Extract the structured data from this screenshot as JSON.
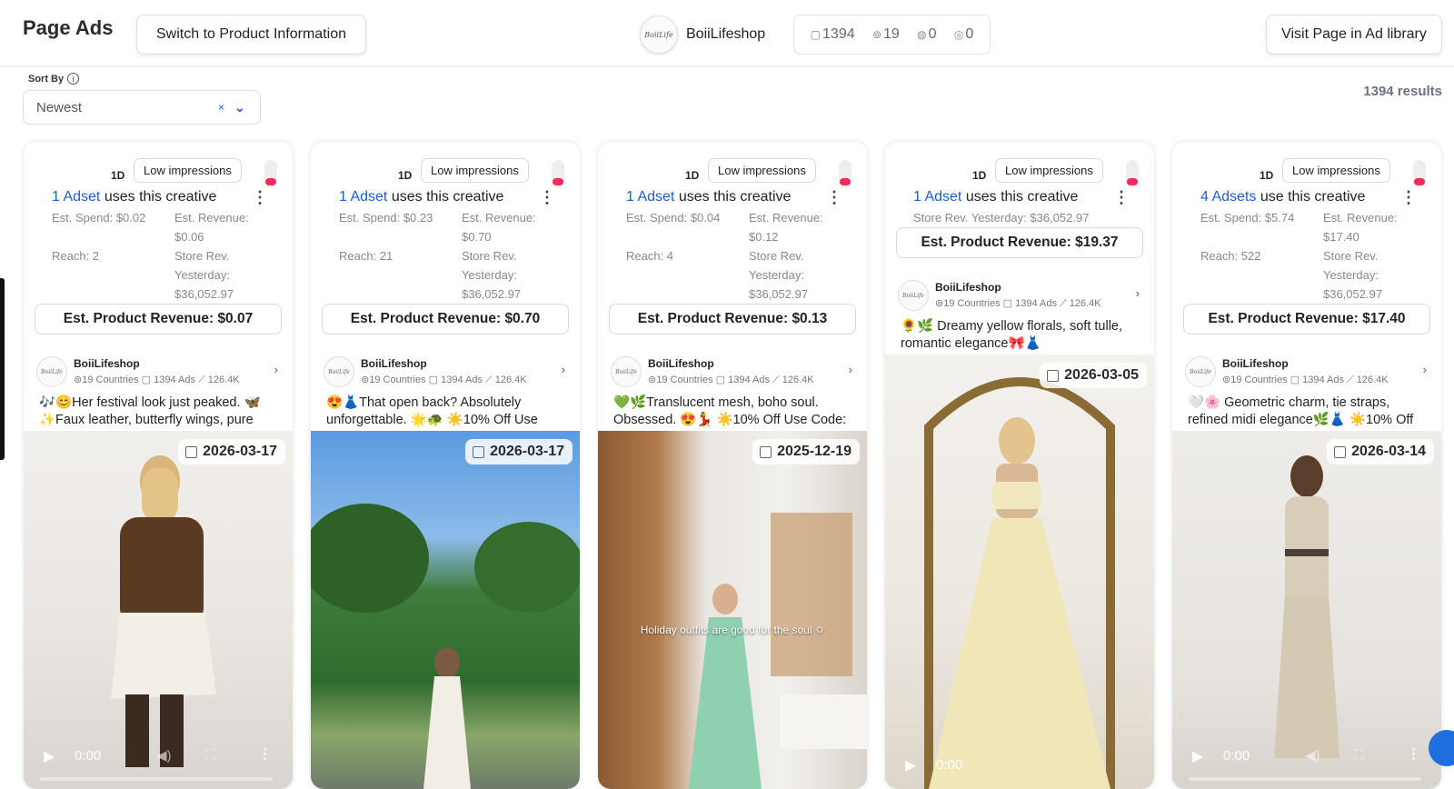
{
  "header": {
    "title": "Page Ads",
    "switch_label": "Switch to Product Information",
    "shop_name": "BoiiLifeshop",
    "shop_logo_text": "BoiiLife",
    "stats": {
      "ads": "1394",
      "countries": "19",
      "fb": "0",
      "ig": "0"
    },
    "visit_label": "Visit Page in Ad library"
  },
  "sort": {
    "label": "Sort By",
    "value": "Newest",
    "clear": "×",
    "info": "i"
  },
  "results_text": "1394 results",
  "cards": [
    {
      "age": "1D",
      "badge": "Low impressions",
      "adset_link": "1 Adset",
      "adset_rest": " uses this creative",
      "spend": "Est. Spend: $0.02",
      "reach": "Reach: 2",
      "revenue_lines": [
        "Est. Revenue:",
        "$0.06"
      ],
      "store_lines": [
        "Store Rev.",
        "Yesterday:",
        "$36,052.97"
      ],
      "product_revenue": "Est. Product Revenue: $0.07",
      "shop": "BoiiLifeshop",
      "mini_stats": "⊚19 Countries  ▢ 1394 Ads  ⟋ 126.4K",
      "caption": "🎶😊Her festival look just peaked. 🦋✨Faux leather, butterfly wings, pure",
      "date": "2026-03-17",
      "time": "0:00",
      "overlay": ""
    },
    {
      "age": "1D",
      "badge": "Low impressions",
      "adset_link": "1 Adset",
      "adset_rest": " uses this creative",
      "spend": "Est. Spend: $0.23",
      "reach": "Reach: 21",
      "revenue_lines": [
        "Est. Revenue:",
        "$0.70"
      ],
      "store_lines": [
        "Store Rev.",
        "Yesterday:",
        "$36,052.97"
      ],
      "product_revenue": "Est. Product Revenue: $0.70",
      "shop": "BoiiLifeshop",
      "mini_stats": "⊚19 Countries  ▢ 1394 Ads  ⟋ 126.4K",
      "caption": "😍👗That open back? Absolutely unforgettable. 🌟🐢 ☀️10% Off Use",
      "date": "2026-03-17",
      "time": "",
      "overlay": ""
    },
    {
      "age": "1D",
      "badge": "Low impressions",
      "adset_link": "1 Adset",
      "adset_rest": " uses this creative",
      "spend": "Est. Spend: $0.04",
      "reach": "Reach: 4",
      "revenue_lines": [
        "Est. Revenue:",
        "$0.12"
      ],
      "store_lines": [
        "Store Rev.",
        "Yesterday:",
        "$36,052.97"
      ],
      "product_revenue": "Est. Product Revenue: $0.13",
      "shop": "BoiiLifeshop",
      "mini_stats": "⊚19 Countries  ▢ 1394 Ads  ⟋ 126.4K",
      "caption": "💚🌿Translucent mesh, boho soul. Obsessed. 😍💃 ☀️10% Off Use Code:",
      "date": "2025-12-19",
      "time": "",
      "overlay": "Holiday outfits are good for the soul 🌣"
    },
    {
      "age": "1D",
      "badge": "Low impressions",
      "adset_link": "1 Adset",
      "adset_rest": " uses this creative",
      "store_single": "Store Rev. Yesterday: $36,052.97",
      "product_revenue": "Est. Product Revenue: $19.37",
      "shop": "BoiiLifeshop",
      "mini_stats": "⊚19 Countries  ▢ 1394 Ads  ⟋ 126.4K",
      "caption": "🌻🌿 Dreamy yellow florals, soft tulle, romantic elegance🎀👗",
      "date": "2026-03-05",
      "time": "0:00",
      "overlay": ""
    },
    {
      "age": "1D",
      "badge": "Low impressions",
      "adset_link": "4 Adsets",
      "adset_rest": " use this creative",
      "spend": "Est. Spend: $5.74",
      "reach": "Reach: 522",
      "revenue_lines": [
        "Est. Revenue:",
        "$17.40"
      ],
      "store_lines": [
        "Store Rev.",
        "Yesterday:",
        "$36,052.97"
      ],
      "product_revenue": "Est. Product Revenue: $17.40",
      "shop": "BoiiLifeshop",
      "mini_stats": "⊚19 Countries  ▢ 1394 Ads  ⟋ 126.4K",
      "caption": "🤍🌸 Geometric charm, tie straps, refined midi elegance🌿👗 ☀️10% Off",
      "date": "2026-03-14",
      "time": "0:00",
      "overlay": ""
    }
  ]
}
